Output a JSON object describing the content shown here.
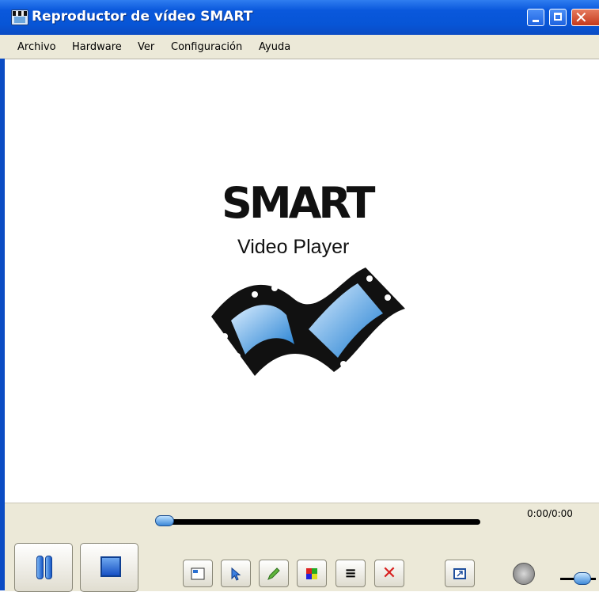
{
  "window": {
    "title": "Reproductor de vídeo SMART",
    "controls": {
      "minimize_icon": "minimize-icon",
      "maximize_icon": "maximize-icon",
      "close_icon": "close-icon"
    }
  },
  "menubar": {
    "items": [
      "Archivo",
      "Hardware",
      "Ver",
      "Configuración",
      "Ayuda"
    ]
  },
  "video": {
    "logo_main": "SMART",
    "logo_sub": "Video Player"
  },
  "playback": {
    "time": "0:00/0:00",
    "position": 0
  },
  "buttons": {
    "pause_icon": "pause-icon",
    "stop_icon": "stop-icon",
    "tools": [
      "capture-icon",
      "select-arrow-icon",
      "pen-icon",
      "color-icon",
      "line-width-icon",
      "delete-icon",
      "fullscreen-icon"
    ],
    "volume_icon": "volume-icon"
  },
  "volume": {
    "level": 0.55
  },
  "colors": {
    "titlebar": "#0755d6",
    "chrome": "#ece9d8",
    "accent": "#3a87d8",
    "close": "#c4391c"
  }
}
